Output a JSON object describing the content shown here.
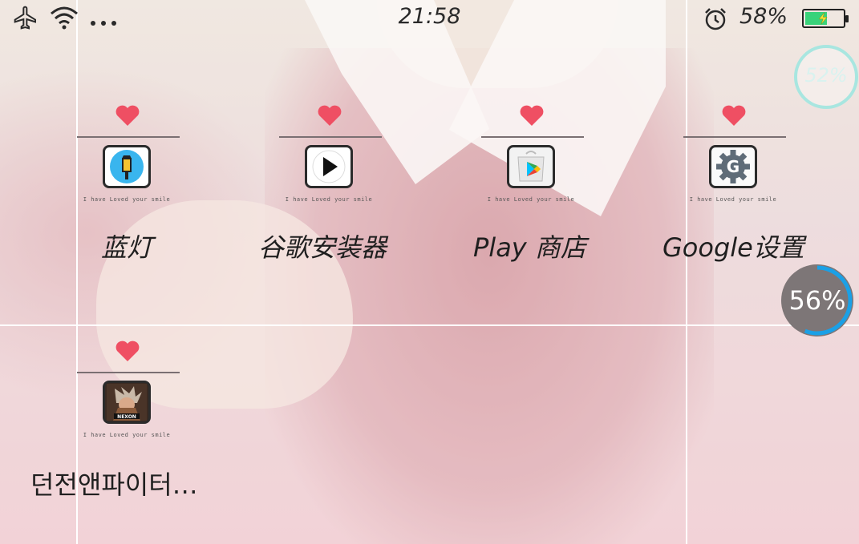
{
  "status_bar": {
    "time": "21:58",
    "battery_text": "58%",
    "battery_level": 0.58,
    "icons": [
      "airplane-icon",
      "wifi-icon",
      "more-dots-icon",
      "alarm-icon",
      "battery-icon"
    ]
  },
  "widgets": {
    "memory_gauge_top": {
      "text": "52%",
      "value": 52
    },
    "memory_gauge_mid": {
      "text": "56%",
      "value": 56
    }
  },
  "tagline": "I have Loved your smile",
  "apps": [
    {
      "label": "蓝灯",
      "icon": "lantern-icon"
    },
    {
      "label": "谷歌安装器",
      "icon": "google-installer-icon"
    },
    {
      "label": "Play 商店",
      "icon": "play-store-icon"
    },
    {
      "label": "Google设置",
      "icon": "google-settings-icon"
    },
    {
      "label": "던전앤파이터…",
      "icon": "dungeon-fighter-icon"
    }
  ],
  "colors": {
    "heart": "#ef4f63",
    "battery_fill": "#39d27a",
    "gauge_ring": "#1aa0e6",
    "gauge_top_ring": "#a8e6e0"
  }
}
